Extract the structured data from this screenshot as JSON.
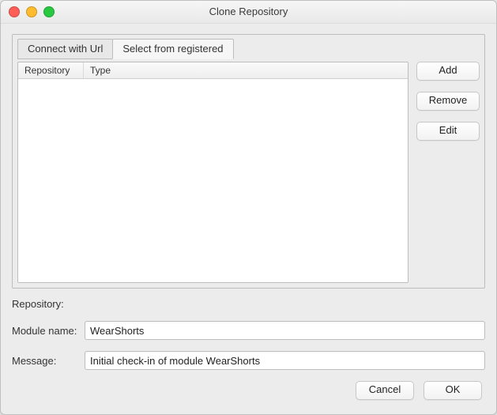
{
  "window": {
    "title": "Clone Repository"
  },
  "tabs": {
    "connect_url": "Connect with Url",
    "select_registered": "Select from registered"
  },
  "table": {
    "columns": {
      "repository": "Repository",
      "type": "Type"
    },
    "rows": []
  },
  "side_buttons": {
    "add": "Add",
    "remove": "Remove",
    "edit": "Edit"
  },
  "form": {
    "repository_label": "Repository:",
    "repository_value": "",
    "module_name_label": "Module name:",
    "module_name_value": "WearShorts",
    "message_label": "Message:",
    "message_value": "Initial check-in of module WearShorts"
  },
  "footer": {
    "cancel": "Cancel",
    "ok": "OK"
  }
}
